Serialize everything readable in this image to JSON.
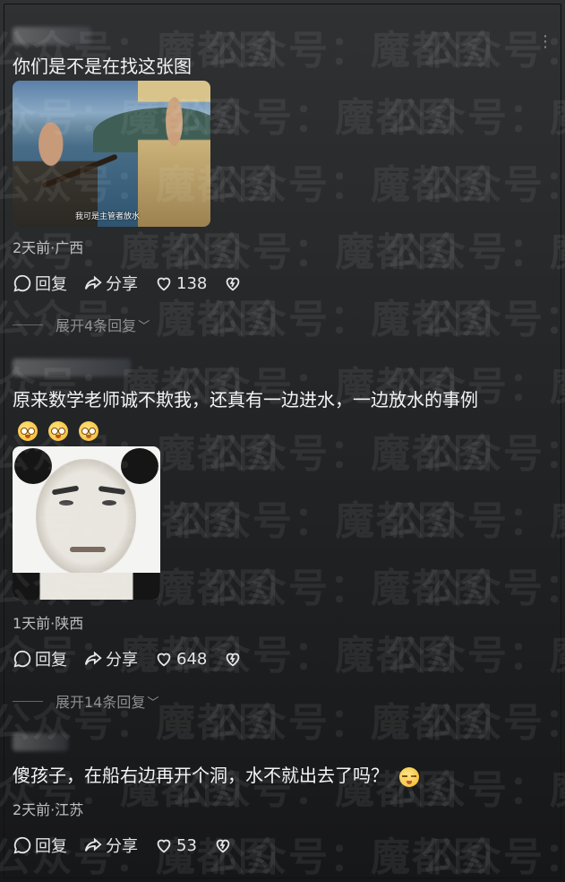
{
  "watermark": "公众号：魔都图",
  "comments": [
    {
      "text": "你们是不是在找这张图",
      "image_caption": "我可是主管者放水",
      "meta": "2天前·广西",
      "reply_label": "回复",
      "share_label": "分享",
      "likes": "138",
      "expand_label": "展开4条回复"
    },
    {
      "text": "原来数学老师诚不欺我，还真有一边进水，一边放水的事例",
      "meta": "1天前·陕西",
      "reply_label": "回复",
      "share_label": "分享",
      "likes": "648",
      "expand_label": "展开14条回复"
    },
    {
      "text": "傻孩子，在船右边再开个洞，水不就出去了吗？",
      "meta": "2天前·江苏",
      "reply_label": "回复",
      "share_label": "分享",
      "likes": "53"
    }
  ],
  "icons": {
    "reply": "chat-bubble-icon",
    "share": "share-arrow-icon",
    "like": "heart-icon",
    "dislike": "broken-heart-icon",
    "more": "more-dots-icon"
  },
  "colors": {
    "background_top": "#2f3133",
    "background_bottom": "#161718",
    "text": "#f4f4f4",
    "meta": "#bfbfbf",
    "expand": "#8f8f8f"
  }
}
